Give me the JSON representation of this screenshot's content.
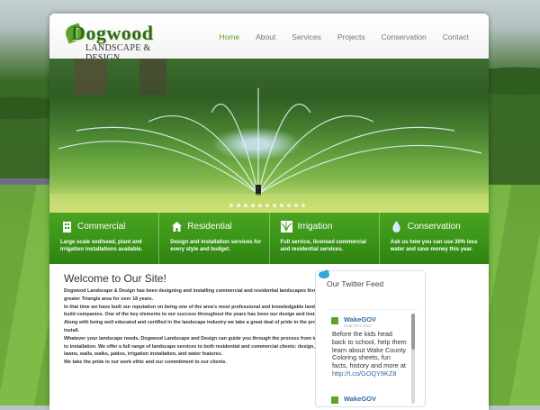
{
  "logo": {
    "title": "Dogwood",
    "subtitle": "LANDSCAPE & DESIGN"
  },
  "nav": {
    "items": [
      {
        "label": "Home",
        "active": true
      },
      {
        "label": "About"
      },
      {
        "label": "Services"
      },
      {
        "label": "Projects"
      },
      {
        "label": "Conservation"
      },
      {
        "label": "Contact"
      }
    ]
  },
  "features": [
    {
      "title": "Commercial",
      "icon": "building-icon",
      "desc": "Large scale sod/seed, plant and irrigation installations available."
    },
    {
      "title": "Residential",
      "icon": "house-icon",
      "desc": "Design and installation services for every style and budget."
    },
    {
      "title": "Irrigation",
      "icon": "sprinkler-icon",
      "desc": "Full service, licensed commercial and residential services."
    },
    {
      "title": "Conservation",
      "icon": "water-drop-icon",
      "desc": "Ask us how you can use 30% less water and save money this year."
    }
  ],
  "content": {
    "title": "Welcome to Our Site!",
    "paragraphs": [
      "Dogwood Landscape & Design has been designing and installing commercial and residential landscapes throughout the greater Triangle area for over 18 years.",
      "In that time we have built our reputation on being one of the area's most professional and knowledgable landscape design-build companies. One of the key elements to our success throughout the years has been our design and installation teams. Along with being well educated and certified in the landscape industry we take a great deal of pride in the projects we install.",
      "Whatever your landscape needs, Dogwood Landscape and Design can guide you through the process from initial concept to installation. We offer a full range of landscape services to both residential and commercial clients: design, planting, lawns, walls, walks, patios, irrigation installation, and water features.",
      "We take the pride in our work ethic and our commitment to our clients."
    ]
  },
  "twitter": {
    "title": "Our Twitter Feed",
    "tweets": [
      {
        "user": "WakeGOV",
        "time": "ONE DAY AGO",
        "text": "Before the kids head back to school, help them learn about Wake County Coloring sheets, fun facts, history and more at ",
        "link": "http://t.co/GOQY9KZ8"
      },
      {
        "user": "WakeGOV"
      }
    ]
  },
  "colors": {
    "accent": "#5aa42a",
    "feature_bar": "#3a9417",
    "link": "#2f6aa3"
  }
}
